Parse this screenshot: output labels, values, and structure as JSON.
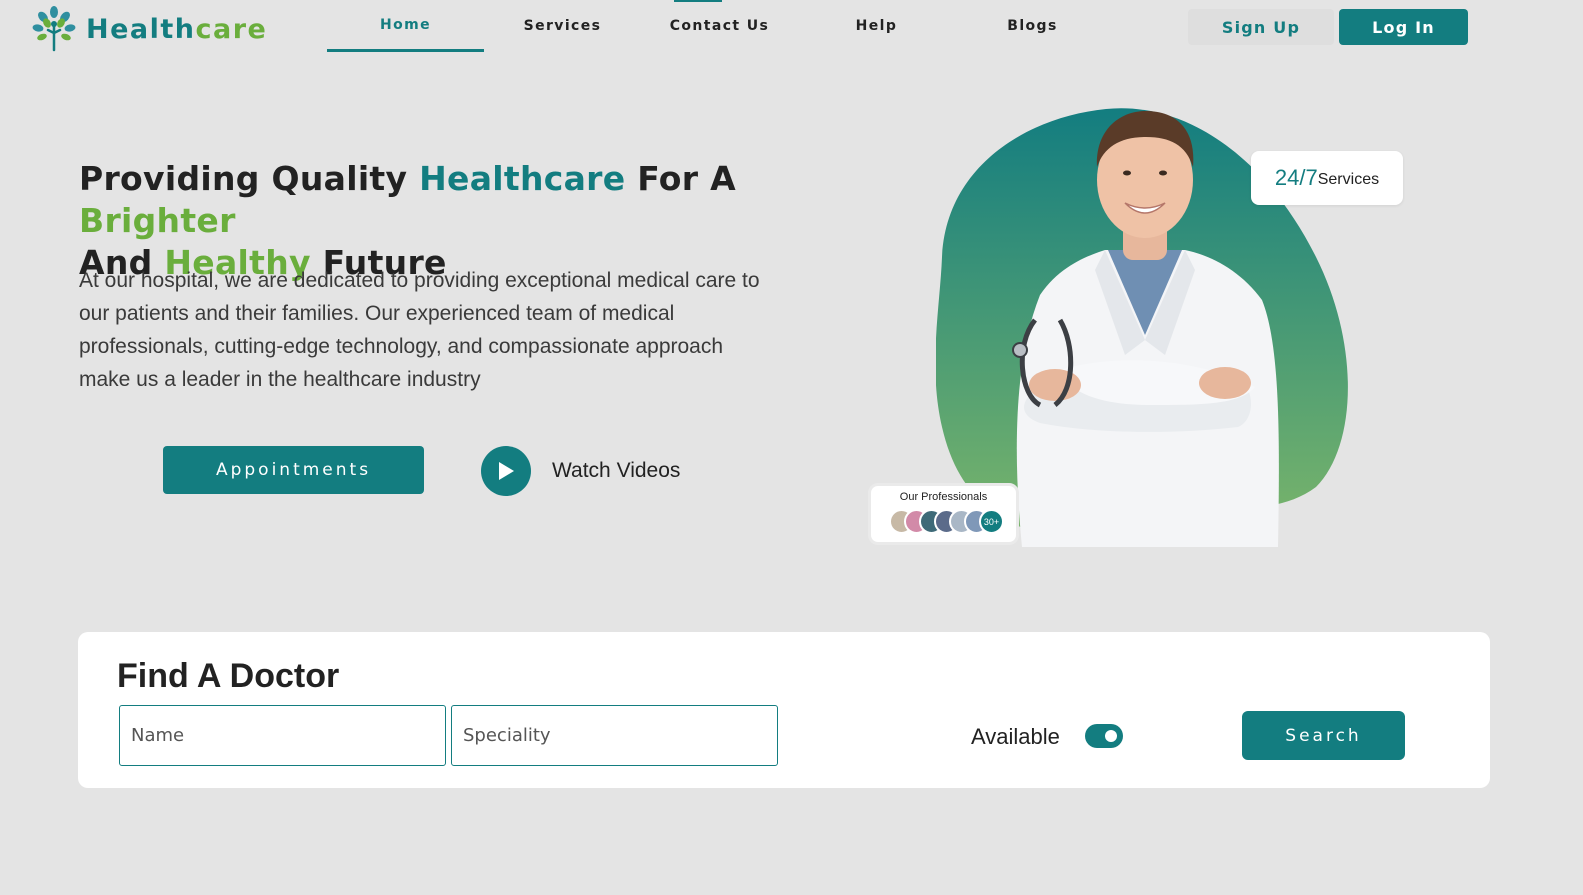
{
  "brand": {
    "name_part1": "Health",
    "name_part2": "care",
    "primary_color": "#137d80",
    "accent_color": "#6aae3c"
  },
  "nav": {
    "links": [
      {
        "label": "Home",
        "active": true
      },
      {
        "label": "Services",
        "active": false
      },
      {
        "label": "Contact Us",
        "active": false
      },
      {
        "label": "Help",
        "active": false
      },
      {
        "label": "Blogs",
        "active": false
      }
    ],
    "signup_label": "Sign Up",
    "login_label": "Log In"
  },
  "hero": {
    "title": {
      "p1": "Providing Quality ",
      "p2": "Healthcare",
      "p3": " For A ",
      "p4": "Brighter",
      "p5": "And ",
      "p6": "Healthy",
      "p7": " Future"
    },
    "description": "At our hospital, we are dedicated to providing exceptional medical care to our patients and their families. Our experienced team of medical professionals, cutting-edge technology, and compassionate approach make us a leader in the healthcare industry",
    "appointments_label": "Appointments",
    "watch_label": "Watch Videos",
    "badge_number": "24/7",
    "badge_text": "Services",
    "professionals_title": "Our Professionals",
    "professionals_count": "30+"
  },
  "finder": {
    "title": "Find A Doctor",
    "name_placeholder": "Name",
    "speciality_placeholder": "Speciality",
    "available_label": "Available",
    "available_on": true,
    "search_label": "Search"
  }
}
